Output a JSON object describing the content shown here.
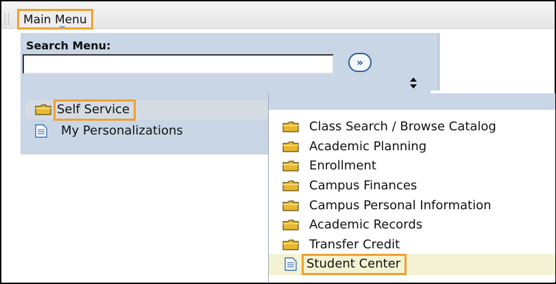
{
  "header": {
    "main_menu_label": "Main Menu"
  },
  "search": {
    "label": "Search Menu:",
    "value": "",
    "placeholder": "",
    "go_button": "»"
  },
  "main_menu": {
    "items": [
      {
        "label": "Self Service",
        "icon": "folder-icon"
      },
      {
        "label": "My Personalizations",
        "icon": "document-icon"
      }
    ]
  },
  "submenu": {
    "items": [
      {
        "label": "Class Search / Browse Catalog",
        "icon": "folder-icon"
      },
      {
        "label": "Academic Planning",
        "icon": "folder-icon"
      },
      {
        "label": "Enrollment",
        "icon": "folder-icon"
      },
      {
        "label": "Campus Finances",
        "icon": "folder-icon"
      },
      {
        "label": "Campus Personal Information",
        "icon": "folder-icon"
      },
      {
        "label": "Academic Records",
        "icon": "folder-icon"
      },
      {
        "label": "Transfer Credit",
        "icon": "folder-icon"
      },
      {
        "label": "Student Center",
        "icon": "document-icon"
      }
    ]
  },
  "colors": {
    "panel": "#c8d6e6",
    "highlight_border": "#f0a030",
    "selected_row": "#f3f2d2",
    "folder": "#e8b830"
  }
}
